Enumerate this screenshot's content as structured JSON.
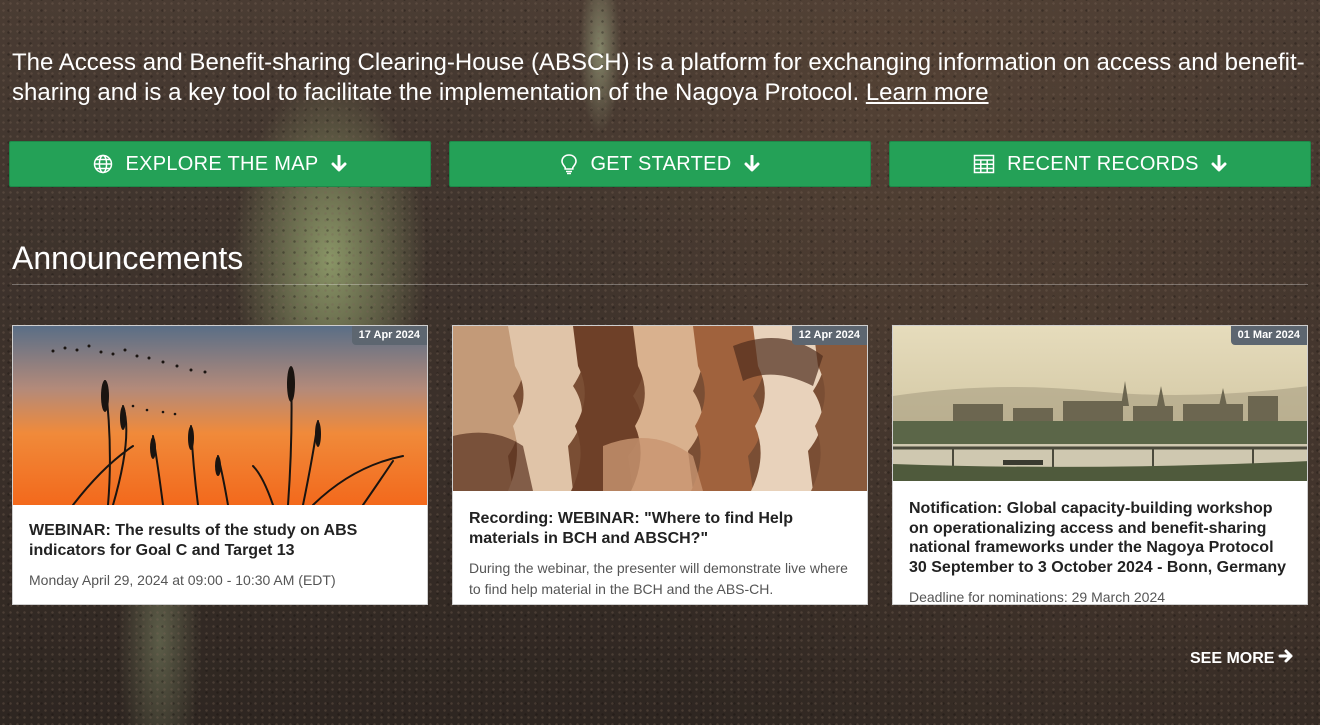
{
  "intro": {
    "text": "The Access and Benefit-sharing Clearing-House (ABSCH) is a platform for exchanging information on access and benefit-sharing and is a key tool to facilitate the implementation of the Nagoya Protocol.",
    "link": "Learn more"
  },
  "actions": [
    {
      "label": "EXPLORE THE MAP",
      "icon": "globe-icon"
    },
    {
      "label": "GET STARTED",
      "icon": "lightbulb-icon"
    },
    {
      "label": "RECENT RECORDS",
      "icon": "table-icon"
    }
  ],
  "announcements": {
    "title": "Announcements",
    "items": [
      {
        "date": "17 Apr 2024",
        "title": "WEBINAR: The results of the study on ABS indicators for Goal C and Target 13",
        "desc": "Monday April 29, 2024 at 09:00 - 10:30 AM (EDT)"
      },
      {
        "date": "12 Apr 2024",
        "title": "Recording: WEBINAR: \"Where to find Help materials in BCH and ABSCH?\"",
        "desc": "During the webinar, the presenter will demonstrate live where to find help material in the BCH and the ABS-CH."
      },
      {
        "date": "01 Mar 2024",
        "title": "Notification: Global capacity-building workshop on operationalizing access and benefit-sharing national frameworks under the Nagoya Protocol 30 September to 3 October 2024 - Bonn, Germany",
        "desc": "Deadline for nominations: 29 March 2024"
      }
    ],
    "see_more": "SEE MORE"
  },
  "colors": {
    "button": "#24a157",
    "badge": "#5d6670"
  }
}
